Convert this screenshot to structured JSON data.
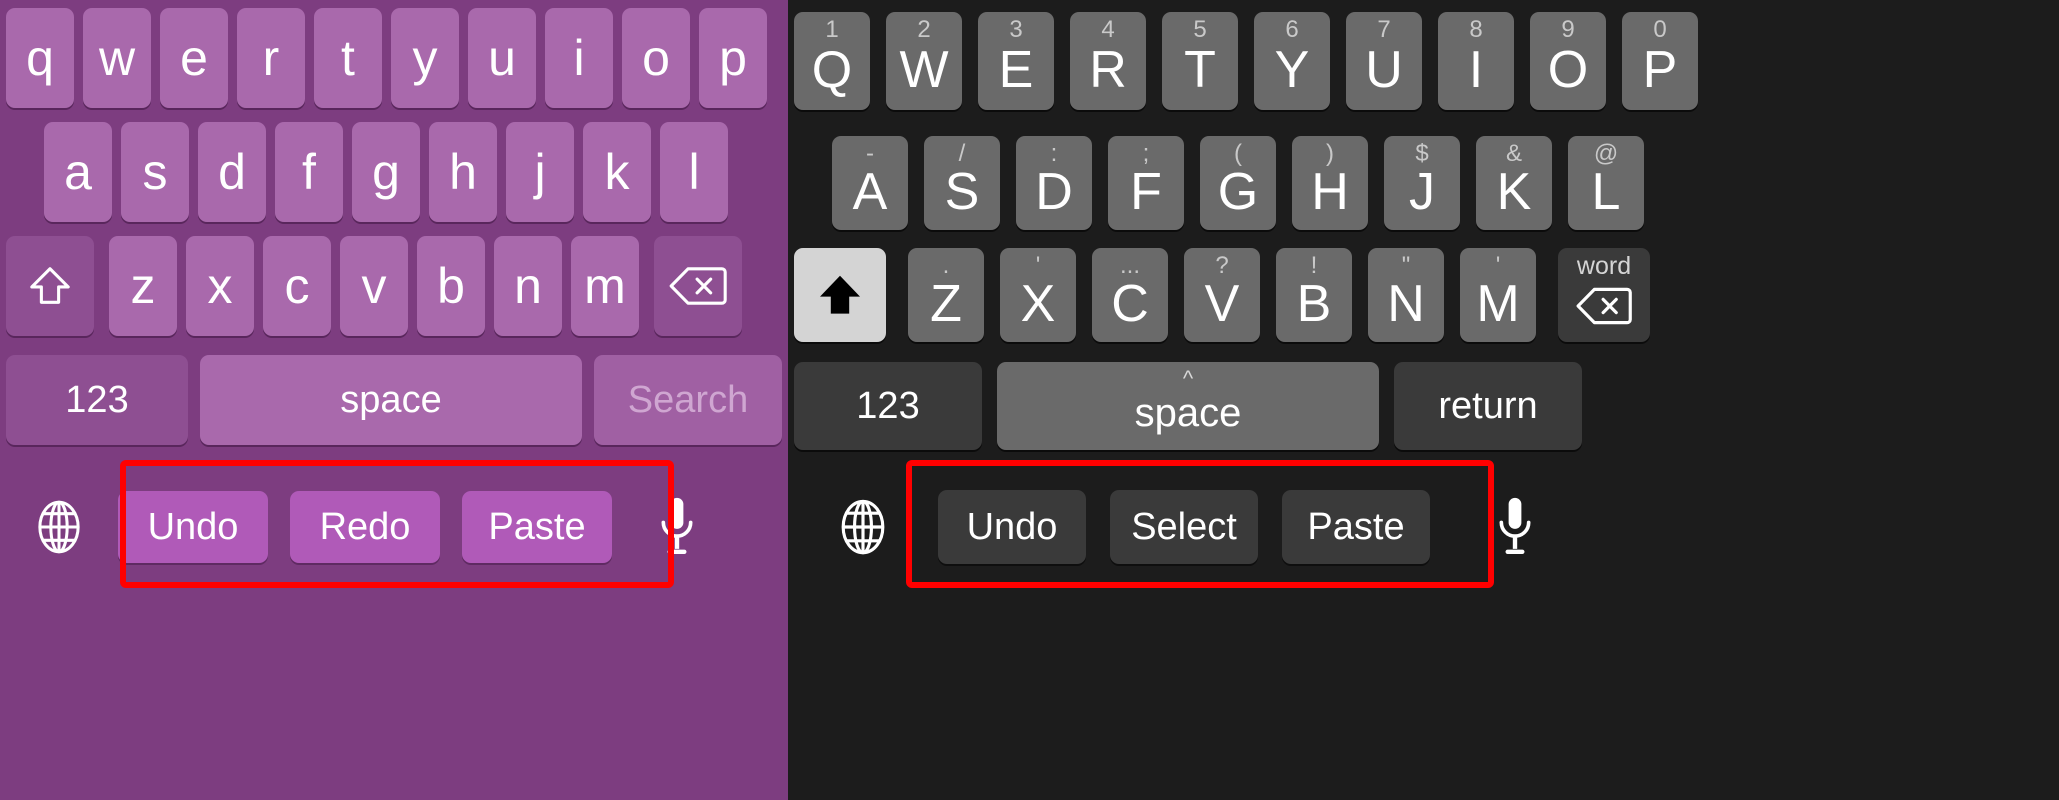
{
  "meta": {
    "description": "Side-by-side comparison of two iOS-style on-screen keyboards with highlighted editing action rows",
    "highlight_color": "#ff0000"
  },
  "panels": [
    {
      "id": "light-purple-keyboard",
      "theme": "light-theme",
      "colors": {
        "background": "#7d3d80",
        "key": "#a969ac",
        "special_key": "#8e4f92",
        "action_key": "#b05ab8",
        "text": "#ffffff",
        "dim_text": "#cfa6d1"
      },
      "rows": [
        {
          "name": "row-1",
          "keys": [
            {
              "label": "q"
            },
            {
              "label": "w"
            },
            {
              "label": "e"
            },
            {
              "label": "r"
            },
            {
              "label": "t"
            },
            {
              "label": "y"
            },
            {
              "label": "u"
            },
            {
              "label": "i"
            },
            {
              "label": "o"
            },
            {
              "label": "p"
            }
          ]
        },
        {
          "name": "row-2",
          "keys": [
            {
              "label": "a"
            },
            {
              "label": "s"
            },
            {
              "label": "d"
            },
            {
              "label": "f"
            },
            {
              "label": "g"
            },
            {
              "label": "h"
            },
            {
              "label": "j"
            },
            {
              "label": "k"
            },
            {
              "label": "l"
            }
          ]
        },
        {
          "name": "row-3",
          "keys": [
            {
              "label": "z"
            },
            {
              "label": "x"
            },
            {
              "label": "c"
            },
            {
              "label": "v"
            },
            {
              "label": "b"
            },
            {
              "label": "n"
            },
            {
              "label": "m"
            }
          ]
        }
      ],
      "shift_key": {
        "name": "shift-key",
        "icon": "shift-arrow-outline-icon",
        "state": "inactive"
      },
      "backspace_key": {
        "name": "backspace-key",
        "icon": "delete-left-icon",
        "hint": ""
      },
      "numbers_key": {
        "label": "123"
      },
      "space_key": {
        "label": "space",
        "caret": ""
      },
      "return_key": {
        "label": "Search",
        "dim": true
      },
      "globe_key": {
        "name": "globe-key",
        "icon": "globe-icon"
      },
      "mic_key": {
        "name": "mic-key",
        "icon": "microphone-icon"
      },
      "actions": [
        {
          "label": "Undo"
        },
        {
          "label": "Redo"
        },
        {
          "label": "Paste"
        }
      ]
    },
    {
      "id": "dark-keyboard",
      "theme": "dark-theme",
      "colors": {
        "background": "#1c1c1c",
        "key": "#6a6a6a",
        "special_key": "#3a3a3a",
        "action_key": "#3a3a3a",
        "shift_active": "#d4d4d4",
        "text": "#ffffff",
        "hint_text": "#c9c9c9"
      },
      "rows": [
        {
          "name": "row-1",
          "keys": [
            {
              "label": "Q",
              "hint": "1"
            },
            {
              "label": "W",
              "hint": "2"
            },
            {
              "label": "E",
              "hint": "3"
            },
            {
              "label": "R",
              "hint": "4"
            },
            {
              "label": "T",
              "hint": "5"
            },
            {
              "label": "Y",
              "hint": "6"
            },
            {
              "label": "U",
              "hint": "7"
            },
            {
              "label": "I",
              "hint": "8"
            },
            {
              "label": "O",
              "hint": "9"
            },
            {
              "label": "P",
              "hint": "0"
            }
          ]
        },
        {
          "name": "row-2",
          "keys": [
            {
              "label": "A",
              "hint": "-"
            },
            {
              "label": "S",
              "hint": "/"
            },
            {
              "label": "D",
              "hint": ":"
            },
            {
              "label": "F",
              "hint": ";"
            },
            {
              "label": "G",
              "hint": "("
            },
            {
              "label": "H",
              "hint": ")"
            },
            {
              "label": "J",
              "hint": "$"
            },
            {
              "label": "K",
              "hint": "&"
            },
            {
              "label": "L",
              "hint": "@"
            }
          ]
        },
        {
          "name": "row-3",
          "keys": [
            {
              "label": "Z",
              "hint": "."
            },
            {
              "label": "X",
              "hint": "'"
            },
            {
              "label": "C",
              "hint": "..."
            },
            {
              "label": "V",
              "hint": "?"
            },
            {
              "label": "B",
              "hint": "!"
            },
            {
              "label": "N",
              "hint": "\""
            },
            {
              "label": "M",
              "hint": "'"
            }
          ]
        }
      ],
      "shift_key": {
        "name": "shift-key",
        "icon": "shift-arrow-filled-icon",
        "state": "active"
      },
      "backspace_key": {
        "name": "backspace-key",
        "icon": "delete-left-icon",
        "hint": "word"
      },
      "numbers_key": {
        "label": "123"
      },
      "space_key": {
        "label": "space",
        "caret": "^"
      },
      "return_key": {
        "label": "return",
        "dim": false
      },
      "globe_key": {
        "name": "globe-key",
        "icon": "globe-icon"
      },
      "mic_key": {
        "name": "mic-key",
        "icon": "microphone-icon"
      },
      "actions": [
        {
          "label": "Undo"
        },
        {
          "label": "Select"
        },
        {
          "label": "Paste"
        }
      ]
    }
  ]
}
